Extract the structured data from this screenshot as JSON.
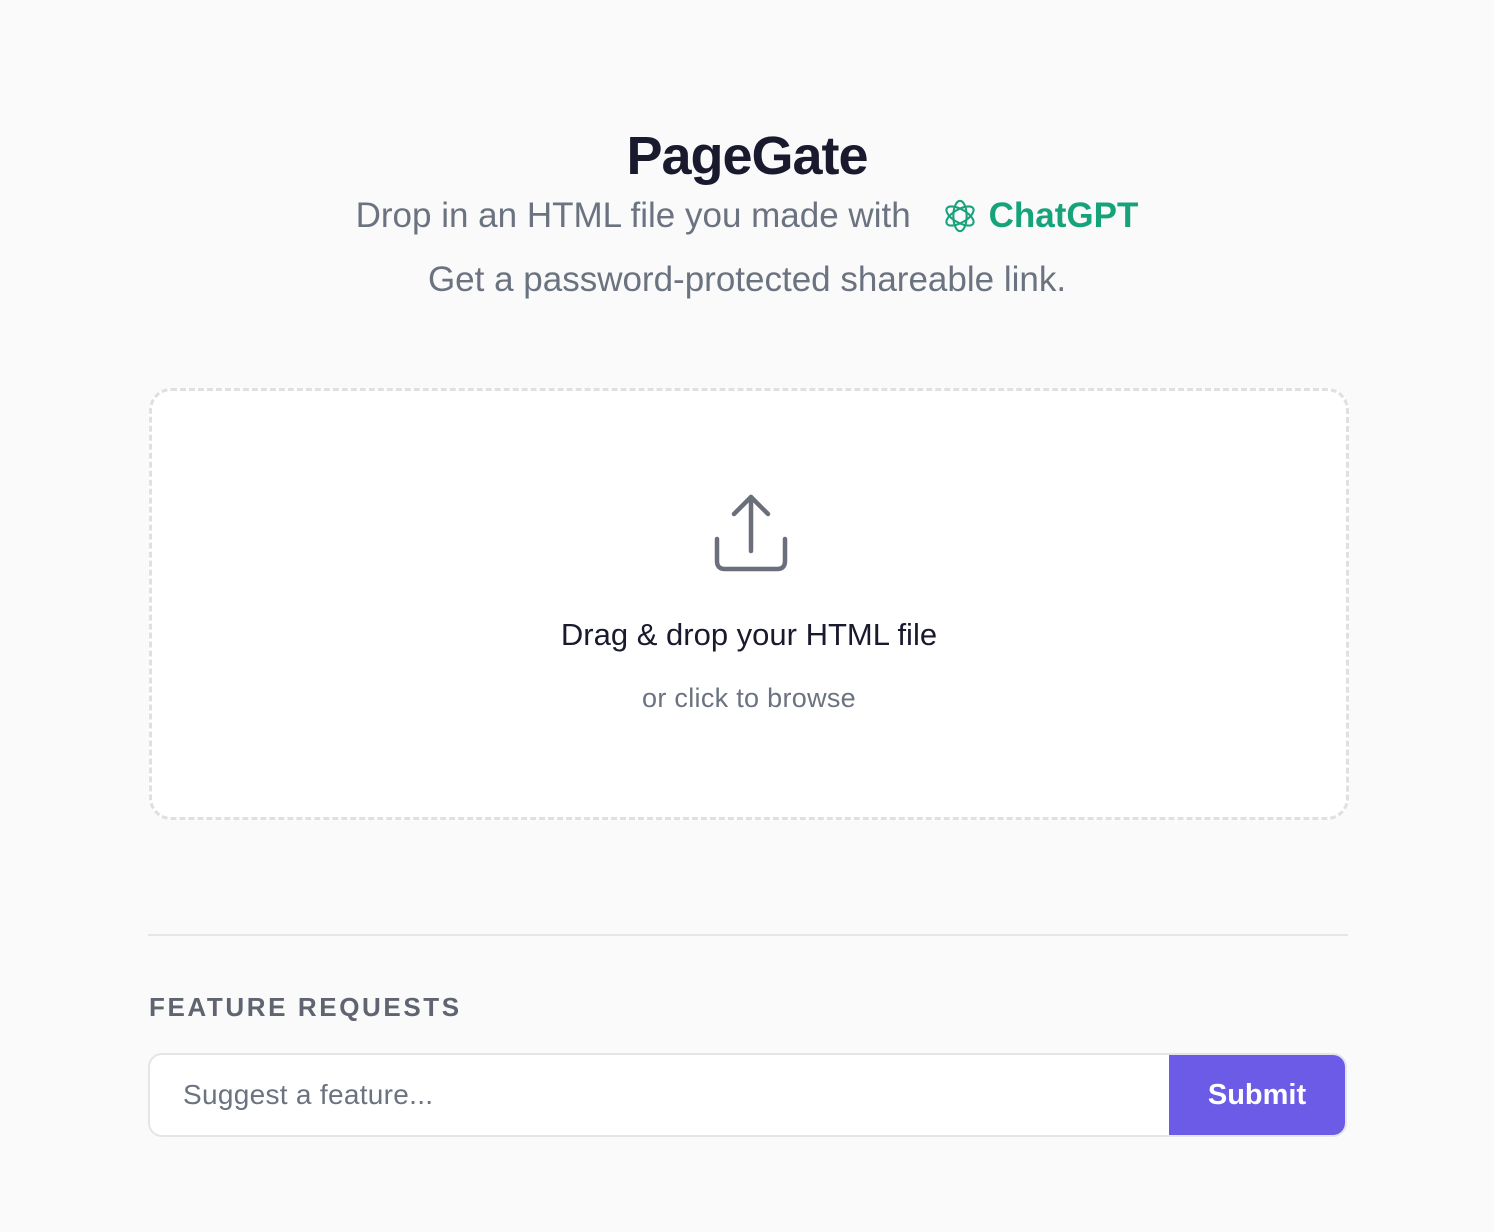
{
  "header": {
    "title": "PageGate",
    "tagline_prefix": "Drop in an HTML file you made with",
    "brand_name": "ChatGPT",
    "subline": "Get a password-protected shareable link."
  },
  "dropzone": {
    "icon": "upload-icon",
    "title": "Drag & drop your HTML file",
    "subtitle": "or click to browse"
  },
  "feature_requests": {
    "label": "FEATURE REQUESTS",
    "input_value": "",
    "placeholder": "Suggest a feature...",
    "submit_label": "Submit"
  },
  "colors": {
    "background": "#fafafa",
    "brand_green": "#17a37a",
    "accent_purple": "#6b5be6",
    "text_dark": "#1a1a2e",
    "text_muted": "#6b7280"
  }
}
